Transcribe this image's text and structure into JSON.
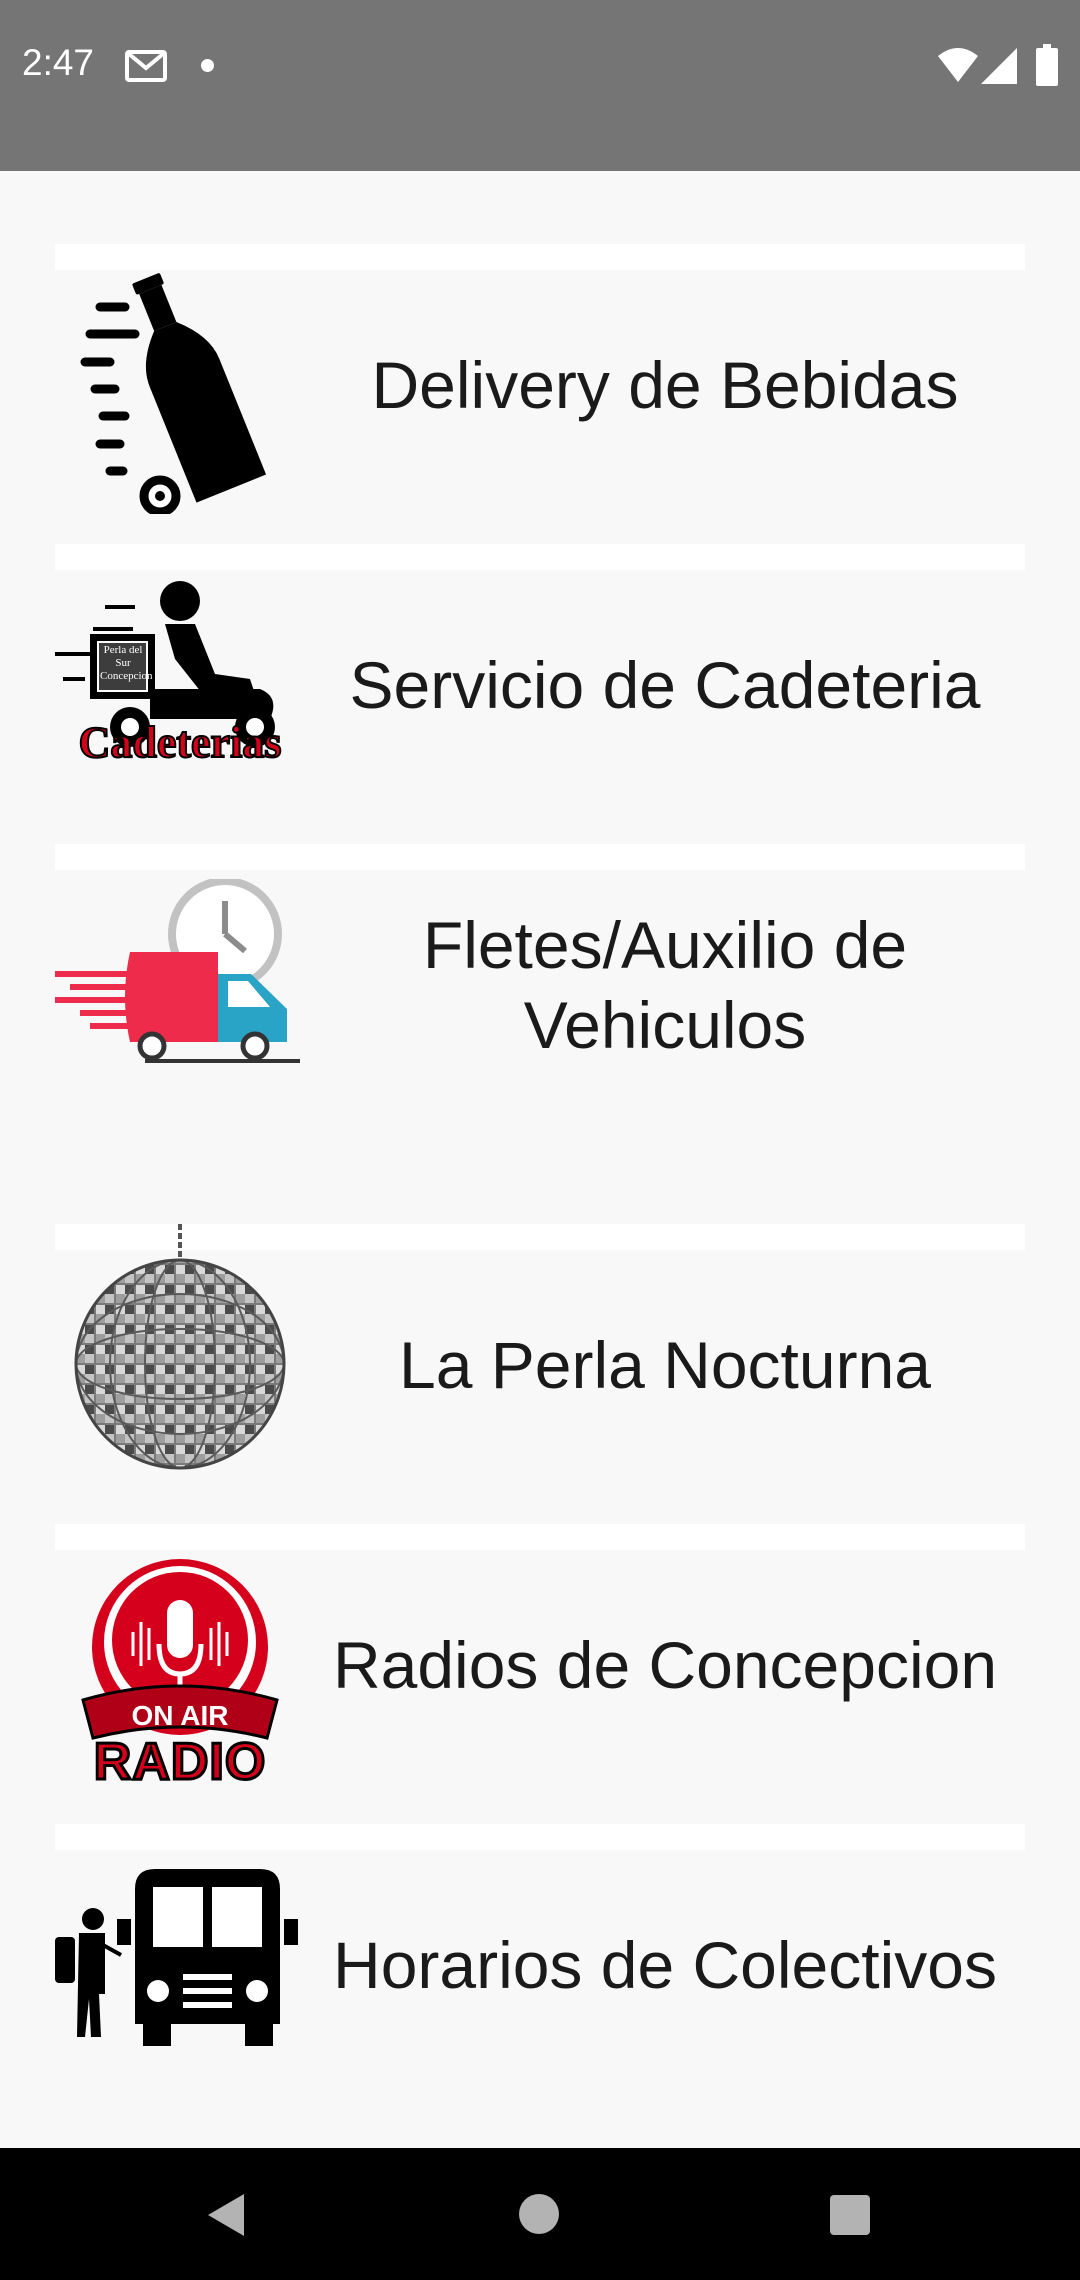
{
  "status_bar": {
    "time": "2:47",
    "icons": [
      "gmail-icon",
      "notification-dot-icon",
      "wifi-icon",
      "signal-icon",
      "battery-icon"
    ],
    "background": "#757575"
  },
  "menu": {
    "items": [
      {
        "label": "Delivery de Bebidas",
        "icon": "bottle-delivery-icon"
      },
      {
        "label": "Servicio de Cadeteria",
        "icon": "cadeterias-icon",
        "icon_caption": "Cadeterias",
        "icon_box_text": "Perla del Sur Concepcion"
      },
      {
        "label": "Fletes/Auxilio de Vehiculos",
        "icon": "delivery-truck-icon"
      },
      {
        "label": "La Perla Nocturna",
        "icon": "disco-ball-icon"
      },
      {
        "label": "Radios de Concepcion",
        "icon": "on-air-radio-icon",
        "icon_caption": "RADIO",
        "icon_badge": "ON AIR"
      },
      {
        "label": "Horarios de Colectivos",
        "icon": "bus-icon"
      }
    ]
  },
  "nav_bar": {
    "buttons": [
      "back-icon",
      "home-icon",
      "recents-icon"
    ]
  },
  "colors": {
    "accent_red": "#d5001c",
    "truck_red": "#ef2b4c",
    "truck_blue": "#2aa4c6"
  }
}
